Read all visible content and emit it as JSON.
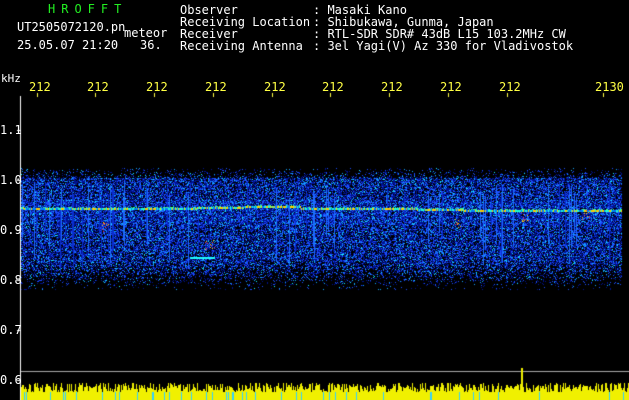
{
  "header": {
    "logo": "HROFFT",
    "filename": "UT2505072120.pn",
    "meteor_label": "meteor",
    "datetime": "25.05.07 21:20",
    "count": "36.",
    "info": [
      {
        "label": "Observer",
        "value": ": Masaki Kano"
      },
      {
        "label": "Receiving Location",
        "value": ": Shibukawa, Gunma, Japan"
      },
      {
        "label": "Receiver",
        "value": ": RTL-SDR SDR# 43dB L15 103.2MHz CW"
      },
      {
        "label": "Receiving Antenna",
        "value": ": 3el Yagi(V) Az 330 for Vladivostok"
      }
    ]
  },
  "axis": {
    "unit": "kHz",
    "time_ticks": [
      "212",
      "212",
      "212",
      "212",
      "212",
      "212",
      "212",
      "212",
      "212",
      "2130"
    ],
    "freq_ticks": [
      "1.1",
      "1.0",
      "0.9",
      "0.8",
      "0.7",
      "0.6"
    ]
  },
  "colors": {
    "background": "#000000",
    "text": "#ffffff",
    "logo": "#22ee22",
    "ticks": "#ffff44",
    "noise_low": "#000a8a",
    "noise_mid": "#1a4cff",
    "noise_high": "#00e0ff",
    "signal": "#ffcc00"
  }
}
